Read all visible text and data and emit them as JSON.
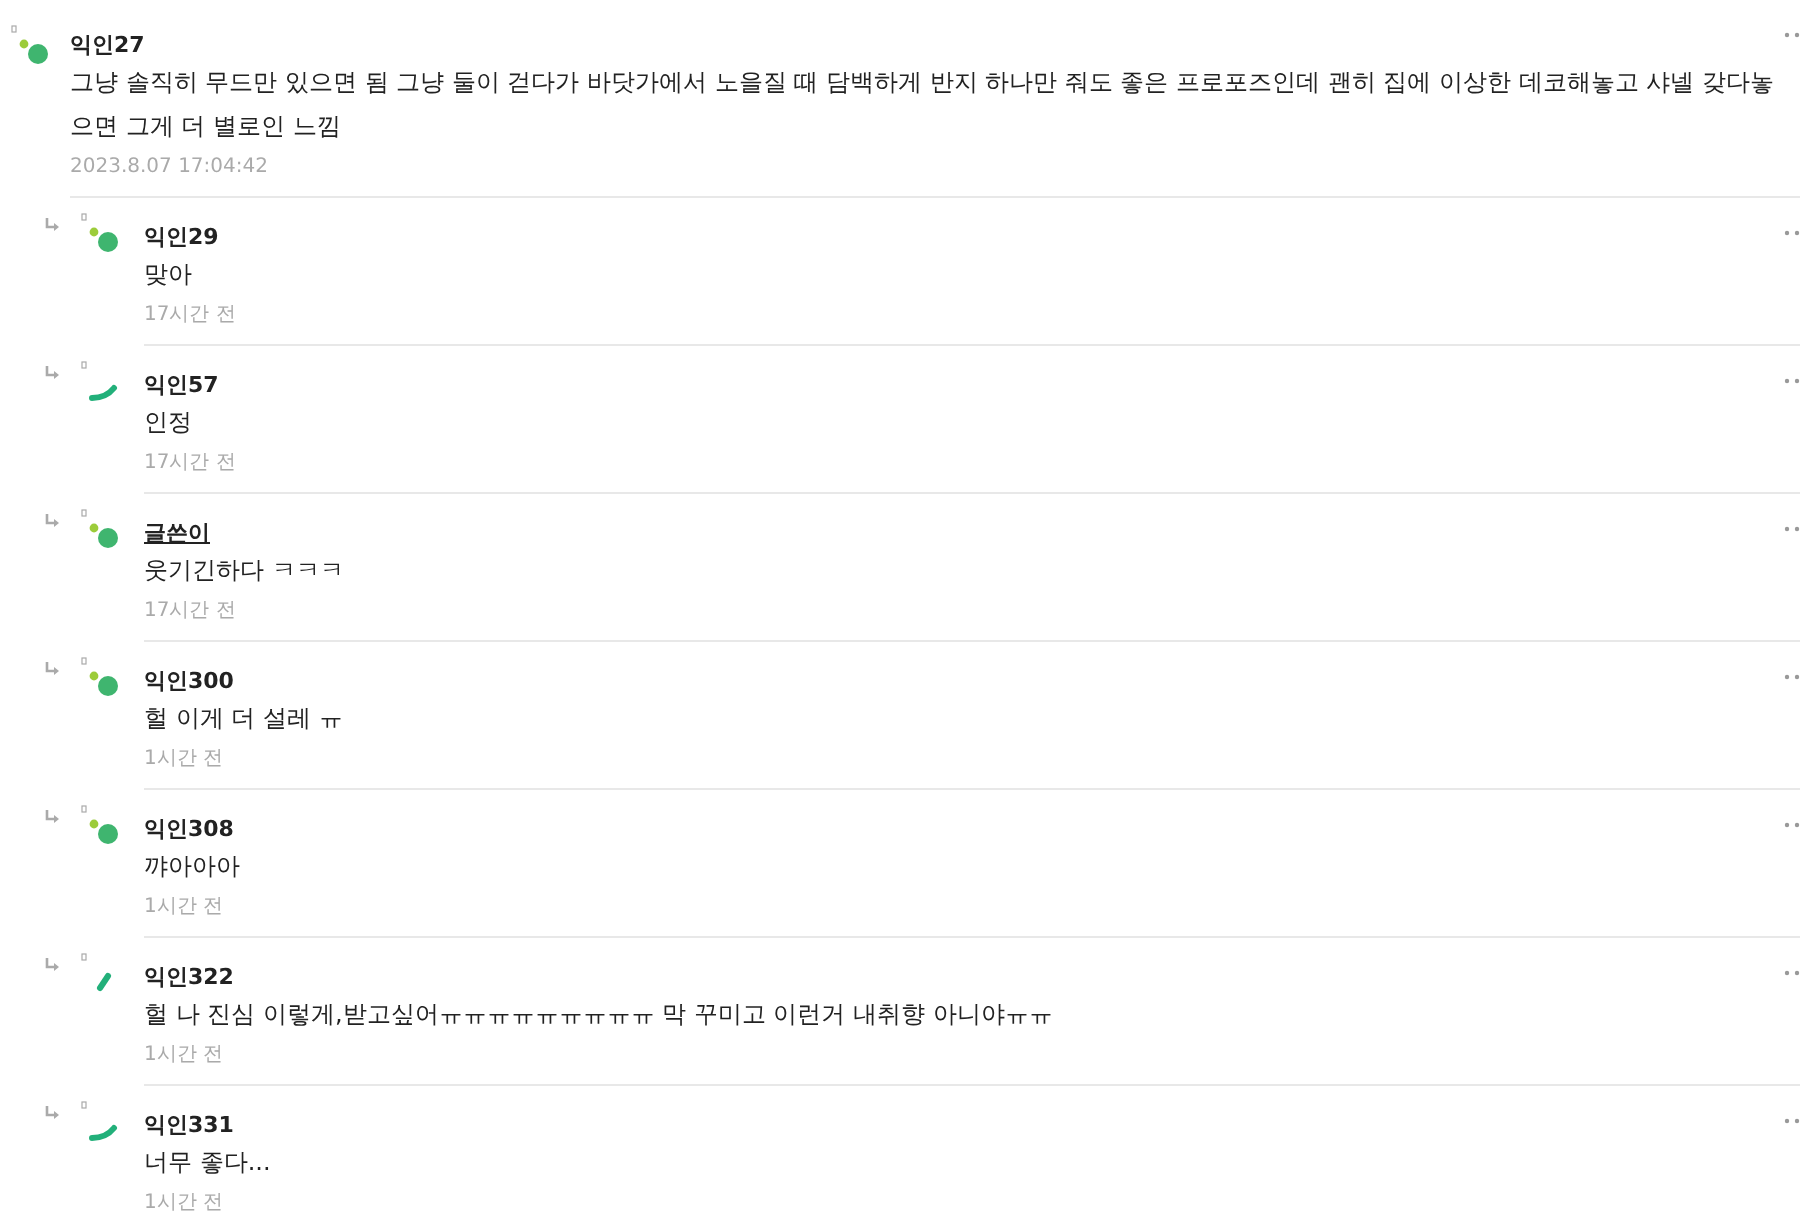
{
  "comment": {
    "author": "익인27",
    "is_author": false,
    "kind": "dots",
    "text": "그냥 솔직히 무드만 있으면 됨 그냥 둘이 걷다가 바닷가에서 노을질 때 담백하게 반지 하나만 줘도 좋은 프로포즈인데 괜히 집에 이상한 데코해놓고 샤넬 갖다놓으면 그게 더 별로인 느낌",
    "time": "2023.8.07 17:04:42"
  },
  "replies": [
    {
      "author": "익인29",
      "is_author": false,
      "kind": "dots",
      "text": "맞아",
      "time": "17시간 전"
    },
    {
      "author": "익인57",
      "is_author": false,
      "kind": "arc",
      "text": "인정",
      "time": "17시간 전"
    },
    {
      "author": "글쓴이",
      "is_author": true,
      "kind": "dots",
      "text": "웃기긴하다 ㅋㅋㅋ",
      "time": "17시간 전"
    },
    {
      "author": "익인300",
      "is_author": false,
      "kind": "dots",
      "text": "헐 이게 더 설레 ㅠ",
      "time": "1시간 전"
    },
    {
      "author": "익인308",
      "is_author": false,
      "kind": "dots",
      "text": "꺄아아아",
      "time": "1시간 전"
    },
    {
      "author": "익인322",
      "is_author": false,
      "kind": "slash",
      "text": "헐 나 진심 이렇게,받고싶어ㅠㅠㅠㅠㅠㅠㅠㅠㅠ 막 꾸미고 이런거 내취향 아니야ㅠㅠ",
      "time": "1시간 전"
    },
    {
      "author": "익인331",
      "is_author": false,
      "kind": "arc",
      "text": "너무 좋다...",
      "time": "1시간 전"
    }
  ]
}
